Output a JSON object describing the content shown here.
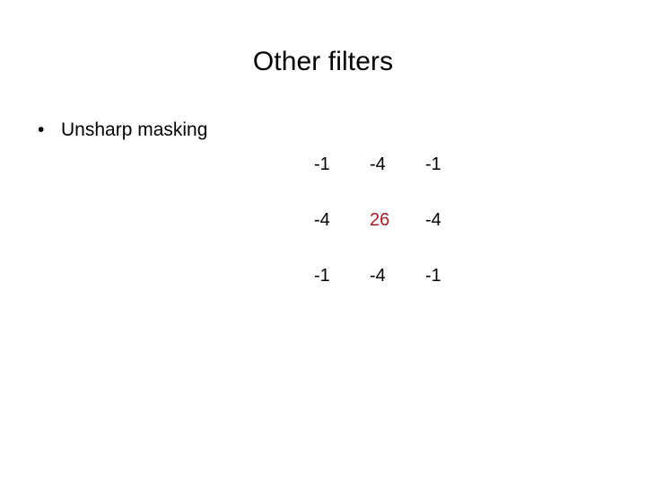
{
  "slide": {
    "title": "Other filters",
    "background_color": "#ffffff",
    "text_color": "#000000"
  },
  "bullets": [
    {
      "marker": "•",
      "label": "Unsharp masking"
    }
  ],
  "kernel": {
    "highlight_color": "#a02025",
    "rows": [
      [
        "-1",
        "-4",
        "-1"
      ],
      [
        "-4",
        "26",
        "-4"
      ],
      [
        "-1",
        "-4",
        "-1"
      ]
    ],
    "r0c0": "-1",
    "r0c1": "-4",
    "r0c2": "-1",
    "r1c0": "-4",
    "r1c1": "26",
    "r1c2": "-4",
    "r2c0": "-1",
    "r2c1": "-4",
    "r2c2": "-1"
  }
}
